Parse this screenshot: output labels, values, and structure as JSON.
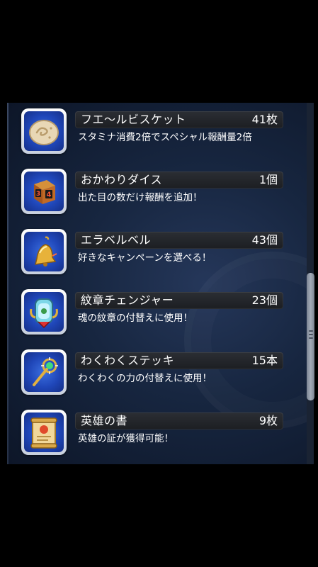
{
  "items": [
    {
      "name": "フエ～ルビスケット",
      "count": "41枚",
      "desc": "スタミナ消費2倍でスペシャル報酬量2倍",
      "icon": "biscuit-icon"
    },
    {
      "name": "おかわりダイス",
      "count": "1個",
      "desc": "出た目の数だけ報酬を追加！",
      "icon": "dice-icon",
      "dice_faces": [
        "3",
        "4"
      ]
    },
    {
      "name": "エラベルベル",
      "count": "43個",
      "desc": "好きなキャンペーンを選べる！",
      "icon": "bell-icon"
    },
    {
      "name": "紋章チェンジャー",
      "count": "23個",
      "desc": "魂の紋章の付替えに使用！",
      "icon": "emblem-changer-icon"
    },
    {
      "name": "わくわくステッキ",
      "count": "15本",
      "desc": "わくわくの力の付替えに使用！",
      "icon": "wand-icon"
    },
    {
      "name": "英雄の書",
      "count": "9枚",
      "desc": "英雄の証が獲得可能！",
      "icon": "scroll-icon"
    }
  ],
  "colors": {
    "panel": "#172640",
    "icon_bg": "#1f46b8",
    "name_bar": "#222428",
    "text": "#ffffff"
  }
}
